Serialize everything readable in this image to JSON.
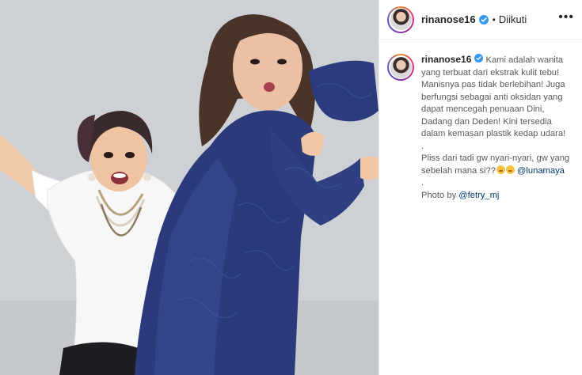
{
  "post": {
    "header": {
      "username": "rinanose16",
      "separator": "•",
      "follow_state": "Diikuti",
      "more_label": "•••",
      "verified_icon": "verified-badge-icon"
    },
    "caption": {
      "username": "rinanose16",
      "lines": [
        "Kami adalah wanita",
        "yang terbuat dari ekstrak kulit tebu!",
        "Manisnya pas tidak berlebihan! Juga",
        "berfungsi sebagai anti oksidan yang",
        "dapat mencegah penuaan Dini,",
        "Dadang dan Deden! Kini tersedia",
        "dalam kemasan plastik kedap udara!",
        ".",
        "Pliss dari tadi gw nyari-nyari, gw yang",
        "sebelah mana si??",
        ".",
        "Photo by "
      ],
      "mention_1": "@lunamaya",
      "mention_2": "@fetry_mj",
      "emoji": "thinking-face-icon"
    },
    "colors": {
      "verified": "#3897f0",
      "link": "#00376b",
      "text": "#262626",
      "background": "#ffffff"
    }
  }
}
